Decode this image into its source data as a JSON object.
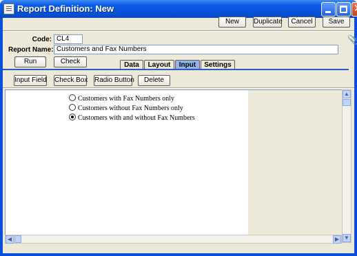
{
  "window": {
    "title": "Report Definition: New"
  },
  "toolbar": {
    "new_label": "New",
    "duplicate_label": "Duplicate",
    "cancel_label": "Cancel",
    "save_label": "Save"
  },
  "form": {
    "code_label": "Code:",
    "code_value": "CL4",
    "report_name_label": "Report Name:",
    "report_name_value": "Customers and Fax Numbers"
  },
  "actions": {
    "run_label": "Run",
    "check_label": "Check"
  },
  "tabs": [
    {
      "label": "Data",
      "active": false
    },
    {
      "label": "Layout",
      "active": false
    },
    {
      "label": "Input",
      "active": true
    },
    {
      "label": "Settings",
      "active": false
    }
  ],
  "input_toolbar": {
    "input_field_label": "Input Field",
    "check_box_label": "Check Box",
    "radio_button_label": "Radio Button",
    "delete_label": "Delete"
  },
  "radio_options": [
    {
      "label": "Customers with Fax Numbers only",
      "selected": false
    },
    {
      "label": "Customers without Fax Numbers only",
      "selected": false
    },
    {
      "label": "Customers with and without Fax Numbers",
      "selected": true
    }
  ],
  "icons": [
    "app-icon",
    "minimize-icon",
    "maximize-icon",
    "close-icon",
    "paperclip-icon"
  ]
}
